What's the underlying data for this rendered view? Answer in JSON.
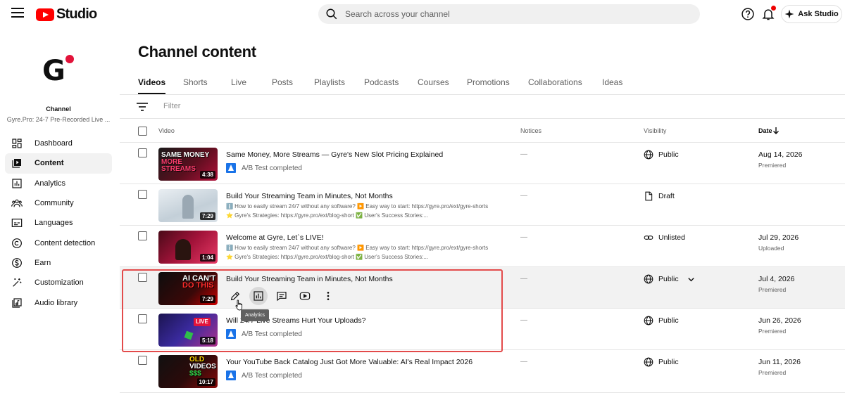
{
  "app": {
    "title": "Studio"
  },
  "search": {
    "placeholder": "Search across your channel"
  },
  "header": {
    "ask_label": "Ask Studio"
  },
  "channel": {
    "label": "Channel",
    "name": "Gyre.Pro: 24-7 Pre-Recorded Live ..."
  },
  "sidebar": {
    "items": [
      {
        "label": "Dashboard",
        "icon": "dashboard-icon"
      },
      {
        "label": "Content",
        "icon": "content-icon",
        "active": true
      },
      {
        "label": "Analytics",
        "icon": "analytics-icon"
      },
      {
        "label": "Community",
        "icon": "community-icon"
      },
      {
        "label": "Languages",
        "icon": "languages-icon"
      },
      {
        "label": "Content detection",
        "icon": "copyright-icon"
      },
      {
        "label": "Earn",
        "icon": "earn-icon"
      },
      {
        "label": "Customization",
        "icon": "customization-icon"
      },
      {
        "label": "Audio library",
        "icon": "audio-library-icon"
      }
    ]
  },
  "page": {
    "title": "Channel content"
  },
  "tabs": [
    "Videos",
    "Shorts",
    "Live",
    "Posts",
    "Playlists",
    "Podcasts",
    "Courses",
    "Promotions",
    "Collaborations",
    "Ideas"
  ],
  "filter": {
    "placeholder": "Filter"
  },
  "table": {
    "headers": {
      "video": "Video",
      "notices": "Notices",
      "visibility": "Visibility",
      "date": "Date"
    }
  },
  "rows": [
    {
      "title": "Same Money, More Streams — Gyre's New Slot Pricing Explained",
      "duration": "4:38",
      "thumb_text": "SAME MONEY\nMORE STREAMS",
      "status": "A/B Test completed",
      "notice": "—",
      "visibility": "Public",
      "date": "Aug 14, 2026",
      "date_sub": "Premiered"
    },
    {
      "title": "Build Your Streaming Team in Minutes, Not Months",
      "duration": "7:29",
      "line1": "ℹ️ How to easily stream 24/7 without any software? ▶️ Easy way to start: https://gyre.pro/ext/gyre-shorts",
      "line2": "⭐ Gyre's Strategies: https://gyre.pro/ext/blog-short ✅ User's Success Stories:...",
      "notice": "—",
      "visibility": "Draft",
      "date": "",
      "date_sub": ""
    },
    {
      "title": "Welcome at Gyre, Let`s LIVE!",
      "duration": "1:04",
      "line1": "ℹ️ How to easily stream 24/7 without any software? ▶️ Easy way to start: https://gyre.pro/ext/gyre-shorts",
      "line2": "⭐ Gyre's Strategies: https://gyre.pro/ext/blog-short ✅ User's Success Stories:...",
      "notice": "—",
      "visibility": "Unlisted",
      "date": "Jul 29, 2026",
      "date_sub": "Uploaded"
    },
    {
      "title": "Build Your Streaming Team in Minutes, Not Months",
      "duration": "7:29",
      "thumb_text": "AI CAN'T\nDO THIS",
      "notice": "—",
      "visibility": "Public",
      "date": "Jul 4, 2026",
      "date_sub": "Premiered"
    },
    {
      "title": "Will 24/7 Live Streams Hurt Your Uploads?",
      "duration": "5:18",
      "thumb_text": "LIVE",
      "status": "A/B Test completed",
      "notice": "—",
      "visibility": "Public",
      "date": "Jun 26, 2026",
      "date_sub": "Premiered"
    },
    {
      "title": "Your YouTube Back Catalog Just Got More Valuable: AI's Real Impact 2026",
      "duration": "10:17",
      "thumb_text": "OLD\nVIDEOS\n$$$",
      "status": "A/B Test completed",
      "notice": "—",
      "visibility": "Public",
      "date": "Jun 11, 2026",
      "date_sub": "Premiered"
    }
  ],
  "tooltip": {
    "label": "Analytics"
  },
  "colors": {
    "brand": "#ff0000",
    "highlight": "#e34b4b",
    "ab_icon": "#1a73e8"
  }
}
